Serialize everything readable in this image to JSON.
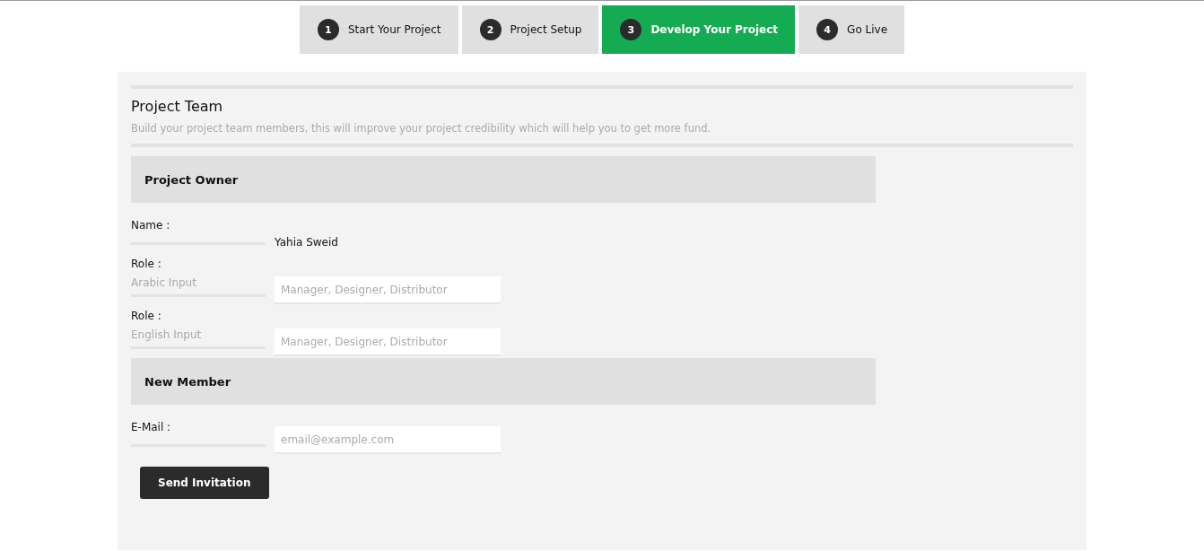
{
  "steps": [
    {
      "number": "1",
      "label": "Start Your Project",
      "selected": false
    },
    {
      "number": "2",
      "label": "Project Setup",
      "selected": false
    },
    {
      "number": "3",
      "label": "Develop Your Project",
      "selected": true
    },
    {
      "number": "4",
      "label": "Go Live",
      "selected": false
    }
  ],
  "panel": {
    "title": "Project Team",
    "subtitle": "Build your project team members, this will improve your project credibility which will help you to get more fund.",
    "sections": [
      {
        "heading": "Project Owner",
        "fields": [
          {
            "kind": "text",
            "label": "Name :",
            "value": "Yahia Sweid"
          },
          {
            "kind": "input",
            "label": "Role :",
            "hint": "Arabic Input",
            "placeholder": "Manager, Designer, Distributor"
          },
          {
            "kind": "input",
            "label": "Role :",
            "hint": "English Input",
            "placeholder": "Manager, Designer, Distributor"
          }
        ]
      },
      {
        "heading": "New Member",
        "fields": [
          {
            "kind": "input",
            "label": "E-Mail :",
            "placeholder": "email@example.com"
          }
        ]
      }
    ],
    "button": "Send Invitation"
  }
}
